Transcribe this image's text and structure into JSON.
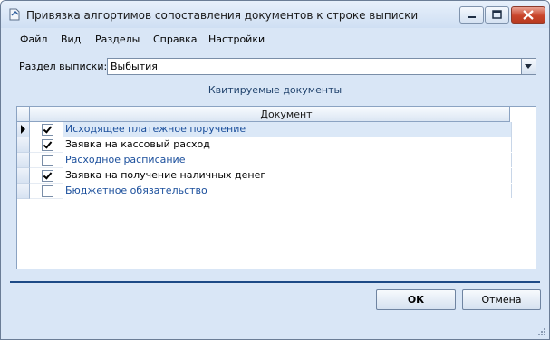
{
  "window": {
    "title": "Привязка алгортимов сопоставления документов к строке выписки"
  },
  "menu": [
    "Файл",
    "Вид",
    "Разделы",
    "Справка",
    "Настройки"
  ],
  "section": {
    "label": "Раздел выписки:",
    "value": "Выбытия"
  },
  "grid": {
    "caption": "Квитируемые документы",
    "column_header": "Документ",
    "rows": [
      {
        "checked": true,
        "label": "Исходящее платежное поручение"
      },
      {
        "checked": true,
        "label": "Заявка на кассовый расход"
      },
      {
        "checked": false,
        "label": "Расходное расписание"
      },
      {
        "checked": true,
        "label": "Заявка на получение наличных денег"
      },
      {
        "checked": false,
        "label": "Бюджетное обязательство"
      }
    ]
  },
  "buttons": {
    "ok": "ОК",
    "cancel": "Отмена"
  }
}
